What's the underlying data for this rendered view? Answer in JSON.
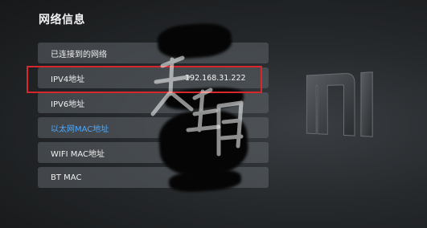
{
  "page": {
    "title": "网络信息"
  },
  "rows": [
    {
      "label": "已连接到的网络",
      "value": ""
    },
    {
      "label": "IPV4地址",
      "value": "192.168.31.222"
    },
    {
      "label": "IPV6地址",
      "value": ""
    },
    {
      "label": "以太网MAC地址",
      "value": ""
    },
    {
      "label": "WIFI MAC地址",
      "value": ""
    },
    {
      "label": "BT MAC",
      "value": ""
    }
  ],
  "colors": {
    "focus": "#4aa8ff",
    "highlight": "#d6282c"
  },
  "icons": [
    "mi-logo",
    "watermark-text"
  ]
}
